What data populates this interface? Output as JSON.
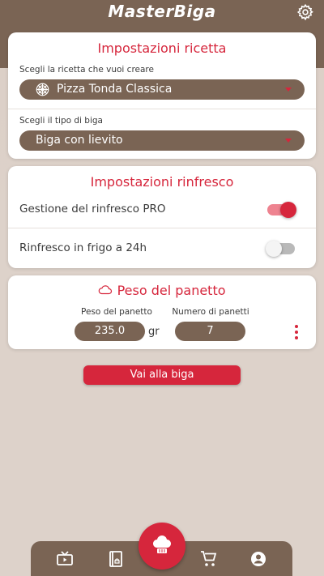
{
  "app": {
    "title": "MasterBiga"
  },
  "recipe_settings": {
    "title": "Impostazioni ricetta",
    "recipe_label": "Scegli la ricetta che vuoi creare",
    "recipe_value": "Pizza Tonda Classica",
    "biga_label": "Scegli il tipo di biga",
    "biga_value": "Biga con lievito"
  },
  "refresh_settings": {
    "title": "Impostazioni rinfresco",
    "pro_label": "Gestione del rinfresco PRO",
    "pro_enabled": true,
    "fridge_label": "Rinfresco in frigo a 24h",
    "fridge_enabled": false
  },
  "dough_weight": {
    "title": "Peso del panetto",
    "weight_label": "Peso del panetto",
    "weight_value": "235.0",
    "unit": "gr",
    "count_label": "Numero di panetti",
    "count_value": "7"
  },
  "cta": {
    "label": "Vai alla biga"
  },
  "bottom_nav": {
    "items": [
      "tv-icon",
      "book-icon",
      "chef-hat-icon",
      "cart-icon",
      "account-icon"
    ]
  },
  "colors": {
    "brown": "#7a6454",
    "red": "#d6263c",
    "background": "#ddd2ca"
  }
}
